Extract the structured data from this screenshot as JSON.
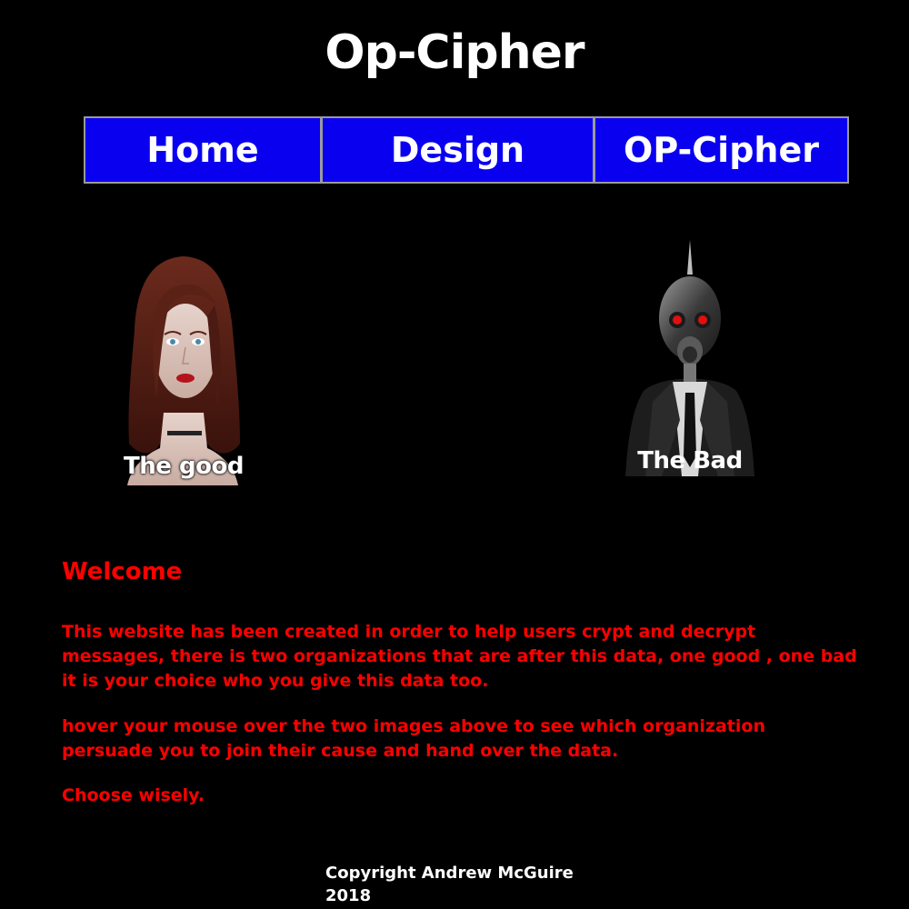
{
  "site_title": "Op-Cipher",
  "nav": {
    "home": "Home",
    "design": "Design",
    "cipher": "OP-Cipher"
  },
  "figures": {
    "good_caption": "The good",
    "bad_caption": "The Bad"
  },
  "content": {
    "heading": "Welcome",
    "paragraph_1": "This website has been created in order to help users crypt and decrypt messages, there is two organizations that are after this data,  one good , one bad it is your choice who you give this data too.",
    "paragraph_2": "hover your mouse over the two images above to see which organization persuade you to join their cause and hand over the data.",
    "paragraph_3": "Choose wisely."
  },
  "footer": {
    "copyright": "Copyright Andrew McGuire",
    "year": "2018"
  },
  "colors": {
    "background": "#000000",
    "nav_background": "#0a00f0",
    "text_accent": "#ff0000"
  }
}
